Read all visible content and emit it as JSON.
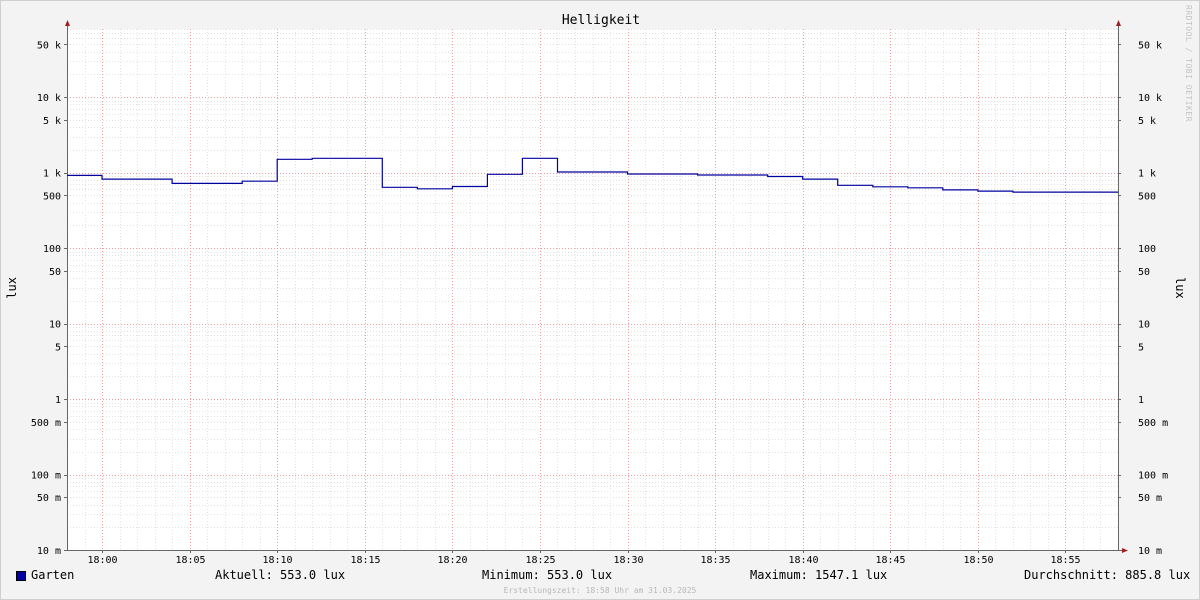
{
  "watermark": "RRDTOOL / TOBI OETIKER",
  "chart_data": {
    "type": "line",
    "title": "Helligkeit",
    "ylabel": "lux",
    "yscale": "log",
    "ylim": [
      0.01,
      80000
    ],
    "xlim": [
      "17:58",
      "18:58"
    ],
    "grid": true,
    "x_tick_labels": [
      "18:00",
      "18:05",
      "18:10",
      "18:15",
      "18:20",
      "18:25",
      "18:30",
      "18:35",
      "18:40",
      "18:45",
      "18:50",
      "18:55"
    ],
    "y_ticks": [
      {
        "value": 50000,
        "label": "50 k"
      },
      {
        "value": 10000,
        "label": "10 k"
      },
      {
        "value": 5000,
        "label": "5 k"
      },
      {
        "value": 1000,
        "label": "1 k"
      },
      {
        "value": 500,
        "label": "500"
      },
      {
        "value": 100,
        "label": "100"
      },
      {
        "value": 50,
        "label": "50"
      },
      {
        "value": 10,
        "label": "10"
      },
      {
        "value": 5,
        "label": "5"
      },
      {
        "value": 1,
        "label": "1"
      },
      {
        "value": 0.5,
        "label": "500 m"
      },
      {
        "value": 0.1,
        "label": "100 m"
      },
      {
        "value": 0.05,
        "label": "50 m"
      },
      {
        "value": 0.01,
        "label": "10 m"
      }
    ],
    "series": [
      {
        "name": "Garten",
        "color": "#0000a0",
        "step": true,
        "x": [
          "17:58",
          "18:00",
          "18:02",
          "18:04",
          "18:06",
          "18:08",
          "18:10",
          "18:12",
          "18:14",
          "18:16",
          "18:18",
          "18:20",
          "18:22",
          "18:24",
          "18:26",
          "18:28",
          "18:30",
          "18:32",
          "18:34",
          "18:36",
          "18:38",
          "18:40",
          "18:42",
          "18:44",
          "18:46",
          "18:48",
          "18:50",
          "18:52",
          "18:54",
          "18:56"
        ],
        "values": [
          920,
          820,
          820,
          720,
          720,
          770,
          1500,
          1547.1,
          1547.1,
          640,
          610,
          655,
          950,
          1547.1,
          1020,
          1020,
          960,
          960,
          930,
          930,
          890,
          820,
          680,
          650,
          630,
          590,
          570,
          553,
          553,
          553
        ]
      }
    ]
  },
  "legend": {
    "series_name": "Garten",
    "current": "Aktuell: 553.0 lux",
    "minimum": "Minimum: 553.0 lux",
    "maximum": "Maximum: 1547.1 lux",
    "average": "Durchschnitt: 885.8 lux"
  },
  "footer": "Erstellungszeit: 18:58 Uhr am 31.03.2025"
}
